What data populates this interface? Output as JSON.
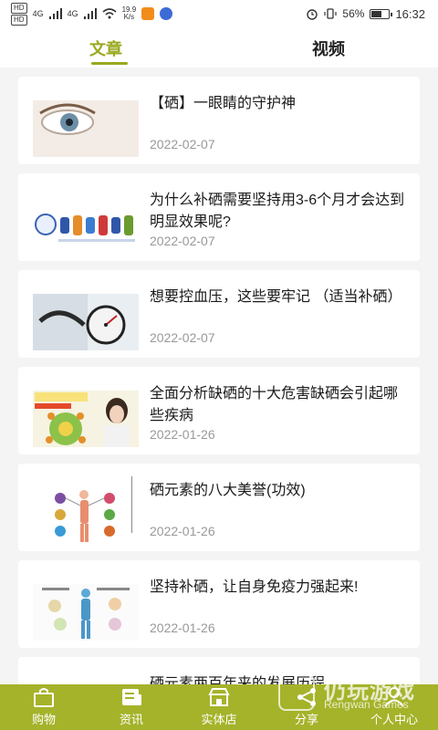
{
  "status_bar": {
    "hd1": "HD",
    "hd2": "HD",
    "net1": "4G",
    "net2": "4G",
    "speed_value": "19.9",
    "speed_unit": "K/s",
    "battery_percent": "56%",
    "battery_level": 0.56,
    "time": "16:32"
  },
  "tabs": [
    {
      "label": "文章",
      "active": true
    },
    {
      "label": "视频",
      "active": false
    }
  ],
  "articles": [
    {
      "title": "【硒】一眼睛的守护神",
      "date": "2022-02-07"
    },
    {
      "title": "为什么补硒需要坚持用3-6个月才会达到明显效果呢?",
      "date": "2022-02-07"
    },
    {
      "title": "想要控血压，这些要牢记 （适当补硒）",
      "date": "2022-02-07"
    },
    {
      "title": "全面分析缺硒的十大危害缺硒会引起哪些疾病",
      "date": "2022-01-26"
    },
    {
      "title": "硒元素的八大美誉(功效)",
      "date": "2022-01-26"
    },
    {
      "title": "坚持补硒，让自身免疫力强起来!",
      "date": "2022-01-26"
    },
    {
      "title": "硒元素两百年来的发展历程",
      "date": ""
    }
  ],
  "bottom_nav": [
    {
      "label": "购物",
      "icon": "shopping-bag-icon"
    },
    {
      "label": "资讯",
      "icon": "news-icon"
    },
    {
      "label": "实体店",
      "icon": "store-icon"
    },
    {
      "label": "分享",
      "icon": "share-icon"
    },
    {
      "label": "个人中心",
      "icon": "person-icon"
    }
  ],
  "watermark": {
    "title": "仍玩游戏",
    "subtitle": "Rengwan Games"
  },
  "colors": {
    "accent": "#9aa91f",
    "nav_bg": "#a5b32a",
    "background": "#f4f4f4",
    "date_text": "#999999"
  }
}
